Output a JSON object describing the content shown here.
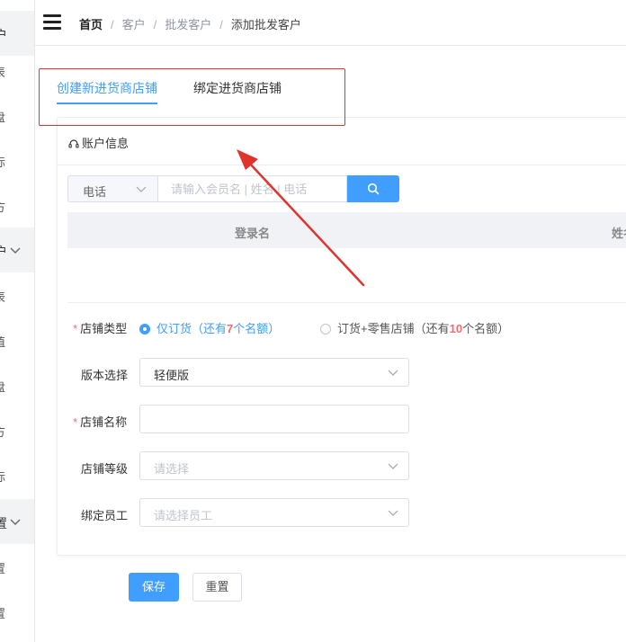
{
  "sidebar": {
    "groups": [
      {
        "text": "户"
      },
      {
        "text": "户"
      },
      {
        "text": "置"
      }
    ],
    "items": [
      "表",
      "盘",
      "标",
      "方",
      "表",
      "值",
      "盘",
      "方",
      "标",
      "置",
      "置"
    ]
  },
  "header": {
    "breadcrumb": {
      "home": "首页",
      "separator": "/",
      "level1": "客户",
      "level2": "批发客户",
      "current": "添加批发客户"
    }
  },
  "tabs": {
    "active": "创建新进货商店铺",
    "inactive": "绑定进货商店铺"
  },
  "account": {
    "title": "账户信息",
    "search_type": "电话",
    "search_placeholder": "请输入会员名 | 姓名 | 电话",
    "columns": [
      "登录名",
      "姓名"
    ]
  },
  "form": {
    "store_type_label": "店铺类型",
    "option1": {
      "prefix": "仅订货（还有",
      "count": "7",
      "suffix": "个名额）"
    },
    "option2": {
      "prefix": "订货+零售店铺（还有",
      "count": "10",
      "suffix": "个名额）"
    },
    "version_label": "版本选择",
    "version_value": "轻便版",
    "store_name_label": "店铺名称",
    "store_level_label": "店铺等级",
    "store_level_placeholder": "请选择",
    "employee_label": "绑定员工",
    "employee_placeholder": "请选择员工"
  },
  "buttons": {
    "save": "保存",
    "reset": "重置"
  },
  "colors": {
    "primary": "#409eff",
    "required": "#f56c6c",
    "annotation": "#e0332c"
  }
}
